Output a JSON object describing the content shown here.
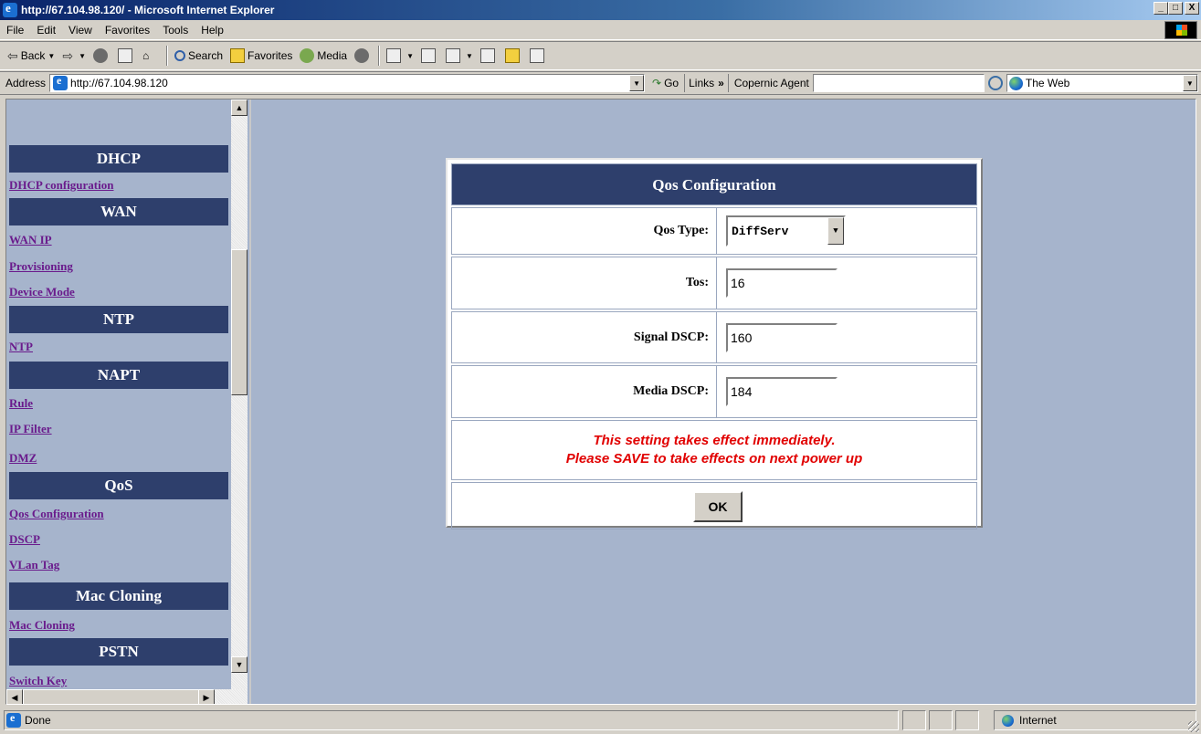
{
  "window": {
    "title": "http://67.104.98.120/ - Microsoft Internet Explorer",
    "minimize": "_",
    "maximize": "□",
    "close": "X"
  },
  "menu": [
    "File",
    "Edit",
    "View",
    "Favorites",
    "Tools",
    "Help"
  ],
  "toolbar": {
    "back": "Back",
    "search": "Search",
    "favorites": "Favorites",
    "media": "Media"
  },
  "address": {
    "label": "Address",
    "url": "http://67.104.98.120",
    "go": "Go",
    "links": "Links",
    "links_more": "»",
    "copernic": "Copernic Agent",
    "web_scope": "The Web"
  },
  "nav": {
    "sections": [
      {
        "header": "DHCP",
        "links": [
          "DHCP configuration"
        ]
      },
      {
        "header": "WAN",
        "links": [
          "WAN IP",
          "Provisioning",
          "Device Mode"
        ]
      },
      {
        "header": "NTP",
        "links": [
          "NTP"
        ]
      },
      {
        "header": "NAPT",
        "links": [
          "Rule",
          "IP Filter",
          "DMZ"
        ]
      },
      {
        "header": "QoS",
        "links": [
          "Qos Configuration",
          "DSCP",
          "VLan Tag"
        ]
      },
      {
        "header": "Mac Cloning",
        "links": [
          "Mac Cloning"
        ]
      },
      {
        "header": "PSTN",
        "links": [
          "Switch Key"
        ]
      }
    ]
  },
  "qos": {
    "title": "Qos Configuration",
    "qos_type_label": "Qos Type:",
    "qos_type_value": "DiffServ",
    "tos_label": "Tos:",
    "tos_value": "16",
    "signal_dscp_label": "Signal DSCP:",
    "signal_dscp_value": "160",
    "media_dscp_label": "Media DSCP:",
    "media_dscp_value": "184",
    "notice_line1": "This setting takes effect immediately.",
    "notice_line2": "Please SAVE to take effects on next power up",
    "ok_label": "OK"
  },
  "status": {
    "text": "Done",
    "zone": "Internet"
  }
}
